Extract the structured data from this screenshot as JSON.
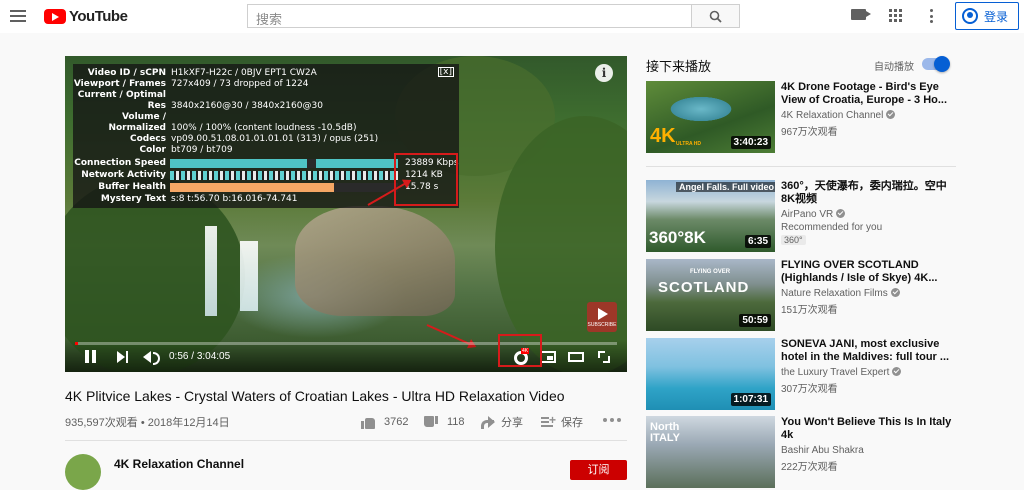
{
  "header": {
    "logo_text": "YouTube",
    "search_placeholder": "搜索",
    "signin_label": "登录"
  },
  "player": {
    "stats": [
      {
        "key": "Video ID / sCPN",
        "value": "H1kXF7-H22c / 0BJV EPT1 CW2A"
      },
      {
        "key": "Viewport / Frames",
        "value": "727x409 / 73 dropped of 1224"
      },
      {
        "key": "Current / Optimal",
        "value": ""
      },
      {
        "key": "Res",
        "value": "3840x2160@30 / 3840x2160@30"
      },
      {
        "key": "Volume /",
        "value": ""
      },
      {
        "key": "Normalized",
        "value": "100% / 100% (content loudness -10.5dB)"
      },
      {
        "key": "Codecs",
        "value": "vp09.00.51.08.01.01.01.01 (313) / opus (251)"
      },
      {
        "key": "Color",
        "value": "bt709 / bt709"
      }
    ],
    "graphs": [
      {
        "key": "Connection Speed",
        "value": "23889 Kbps"
      },
      {
        "key": "Network Activity",
        "value": "1214 KB"
      },
      {
        "key": "Buffer Health",
        "value": "15.78 s"
      }
    ],
    "mystery": {
      "key": "Mystery Text",
      "value": "s:8 t:56.70 b:16.016-74.741"
    },
    "close_label": "[x]",
    "info_label": "i",
    "watermark_label": "SUBSCRIBE",
    "current_time": "0:56",
    "duration": "3:04:05",
    "time_sep": " / ",
    "progress_fraction": 0.005,
    "quality_badge": "4K"
  },
  "video": {
    "title": "4K Plitvice Lakes - Crystal Waters of Croatian Lakes - Ultra HD Relaxation Video",
    "meta": "935,597次观看 • 2018年12月14日",
    "likes": "3762",
    "dislikes": "118",
    "share": "分享",
    "save": "保存"
  },
  "channel": {
    "name": "4K Relaxation Channel",
    "subscribe": "订阅"
  },
  "sidebar": {
    "up_next": "接下来播放",
    "autoplay": "自动播放",
    "autoplay_on": true,
    "items": [
      {
        "title": "4K Drone Footage - Bird's Eye View of Croatia, Europe - 3 Ho...",
        "channel": "4K Relaxation Channel",
        "views": "967万次观看",
        "duration": "3:40:23",
        "thumb_text": "4K",
        "thumb_sub": "ULTRA HD",
        "badge": ""
      },
      {
        "title": "360°，天使瀑布，委内瑞拉。空中8K视频",
        "channel": "AirPano VR",
        "views": "Recommended for you",
        "duration": "6:35",
        "thumb_text": "360°8K",
        "thumb_top": "Angel Falls. Full video",
        "badge": "360°"
      },
      {
        "title": "FLYING OVER SCOTLAND (Highlands / Isle of Skye) 4K...",
        "channel": "Nature Relaxation Films",
        "views": "151万次观看",
        "duration": "50:59",
        "thumb_text": "SCOTLAND",
        "thumb_sub": "FLYING OVER",
        "badge": ""
      },
      {
        "title": "SONEVA JANI, most exclusive hotel in the Maldives: full tour ...",
        "channel": "the Luxury Travel Expert",
        "views": "307万次观看",
        "duration": "1:07:31",
        "thumb_text": "",
        "badge": ""
      },
      {
        "title": "You Won't Believe This Is In Italy 4k",
        "channel": "Bashir Abu Shakra",
        "views": "222万次观看",
        "duration": "",
        "thumb_text": "North ITALY",
        "badge": ""
      }
    ]
  },
  "colors": {
    "brand_red": "#ff0000",
    "link_blue": "#065fd4",
    "annotation_red": "#d61b1b"
  }
}
